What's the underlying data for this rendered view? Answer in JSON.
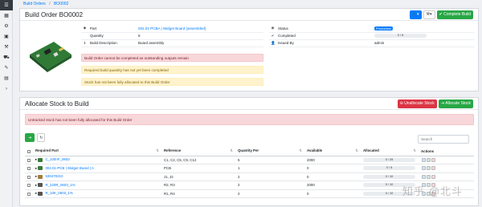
{
  "sidebar": [
    "menu-icon",
    "dashboard-icon",
    "parts-icon",
    "stock-icon",
    "build-icon",
    "purchase-icon",
    "sales-icon",
    "settings-icon",
    "expand-icon"
  ],
  "breadcrumb": {
    "root": "Build Orders",
    "current": "BO0002"
  },
  "build": {
    "title": "Build Order BO0002",
    "complete_label": "Complete Build",
    "rows_left": [
      {
        "label": "Part",
        "value": "002.01-PCBA | Widget Board (assembled)",
        "is_link": true
      },
      {
        "label": "Quantity",
        "value": "5",
        "is_link": false
      },
      {
        "label": "Build Description",
        "value": "Board assembly",
        "is_link": false
      }
    ],
    "rows_right": [
      {
        "label": "Status",
        "badge": "Production"
      },
      {
        "label": "Completed",
        "progress": "0 / 5"
      },
      {
        "label": "Issued By",
        "value": "admin"
      }
    ],
    "alerts": [
      {
        "text": "Build Order cannot be completed as outstanding outputs remain",
        "kind": "danger"
      },
      {
        "text": "Required build quantity has not yet been completed",
        "kind": "warning"
      },
      {
        "text": "Stock has not been fully allocated to this Build Order",
        "kind": "warning"
      }
    ]
  },
  "allocate": {
    "title": "Allocate Stock to Build",
    "unallocate_label": "Unallocate Stock",
    "allocate_label": "Allocate Stock",
    "alert": "Untracked stock has not been fully allocated for this Build Order",
    "search_placeholder": "Search",
    "columns": [
      "Required Part",
      "Reference",
      "Quantity Per",
      "Available",
      "Allocated",
      "Actions"
    ],
    "rows": [
      {
        "part": "C_100nF_0603",
        "reference": "C1, C2, C5, C9, C12",
        "qty": "5",
        "available": "2000",
        "allocated": "0 / 25"
      },
      {
        "part": "002.01-PCB | Widget Board | A",
        "reference": "PCB",
        "qty": "1",
        "available": "0",
        "allocated": "0 / 5"
      },
      {
        "part": "530470210",
        "reference": "J1, J2",
        "qty": "2",
        "available": "0",
        "allocated": "0 / 10"
      },
      {
        "part": "R_220R_0603_1%",
        "reference": "R2, R3",
        "qty": "2",
        "available": "2000",
        "allocated": "0 / 10"
      },
      {
        "part": "R_10K_0603_1%",
        "reference": "R1, R4",
        "qty": "2",
        "available": "0",
        "allocated": "0 / 10"
      }
    ]
  },
  "watermark": "知乎 @北斗"
}
